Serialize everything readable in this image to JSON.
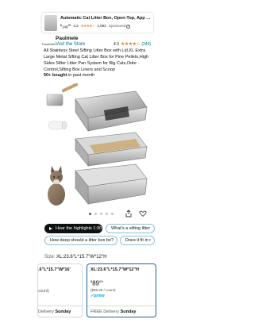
{
  "ad": {
    "title": "Automatic Cat Litter Box, Open-Top, App Contro...",
    "price_whole": "149",
    "price_fraction": "99",
    "price_symbol": "$",
    "rating": "4.2",
    "stars": "★★★★☆",
    "reviews": "1,093",
    "sponsored": "Sponsored",
    "info": "i"
  },
  "brand": {
    "logo": "PaulMele",
    "name": "Paulmele",
    "visit_store": "Visit the Store",
    "rating": "4.3",
    "stars": "★★★★☆",
    "count": "(249)"
  },
  "product": {
    "title": "All Stainless Steel Sifting Litter Box with Lid,XL Extra Large Metal Sifting Cat Litter Box for Pine Pellets,High Sides Sifter Litter Pan System for Big Cats,Odor Control,Sifting Box Liners and Scoop",
    "bought_bold": "50+ bought",
    "bought_rest": " in past month"
  },
  "carousel": {
    "total_dots": 5,
    "active_dot": 1
  },
  "chips": {
    "highlights": "Hear the highlights 1:30",
    "q1": "What's a sifting litter",
    "q2": "How deep should a litter box be?",
    "q3": "Does it fit in r"
  },
  "size": {
    "label": "Size: ",
    "value": "XL:23.6\"L*15.7\"W*12\"H"
  },
  "options": [
    {
      "name": ".6\"L*15.7\"W*16'",
      "qty": "count)",
      "delivery_prefix": "Delivery ",
      "delivery_day": "Sunday"
    },
    {
      "name": "XL:23.6\"L*15.7\"W*12\"H",
      "price_symbol": "$",
      "price_whole": "89",
      "price_fraction": "99",
      "unit": "($89.99 / count)",
      "prime": "prime",
      "delivery_prefix": "FREE Delivery ",
      "delivery_day": "Sunday"
    }
  ],
  "colors": {
    "link": "#007185",
    "star": "#de7921",
    "selected_border": "#2162a1",
    "prime": "#00a8e1"
  }
}
